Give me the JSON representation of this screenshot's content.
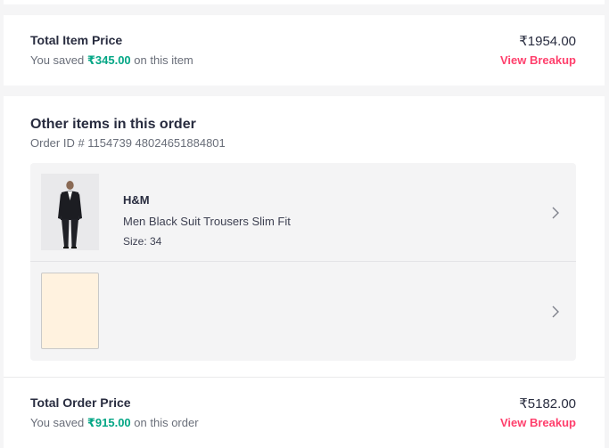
{
  "item_price": {
    "title": "Total Item Price",
    "saved_prefix": "You saved ",
    "saved_amount": "₹345.00",
    "saved_suffix": " on this item",
    "value": "₹1954.00",
    "breakup_label": "View Breakup"
  },
  "other_items": {
    "title": "Other items in this order",
    "order_id": "Order ID # 1154739 48024651884801",
    "items": [
      {
        "brand": "H&M",
        "name": "Men Black Suit Trousers Slim Fit",
        "size": "Size: 34"
      },
      {
        "brand": "",
        "name": "",
        "size": ""
      }
    ]
  },
  "order_total": {
    "title": "Total Order Price",
    "saved_prefix": "You saved ",
    "saved_amount": "₹915.00",
    "saved_suffix": " on this order",
    "value": "₹5182.00",
    "breakup_label": "View Breakup"
  },
  "colors": {
    "accent": "#ff3f6c",
    "savings": "#03a685",
    "placeholder": "#fff2df"
  },
  "icons": {
    "chevron": "chevron-right-icon",
    "product_photo": "suit-model-image"
  }
}
